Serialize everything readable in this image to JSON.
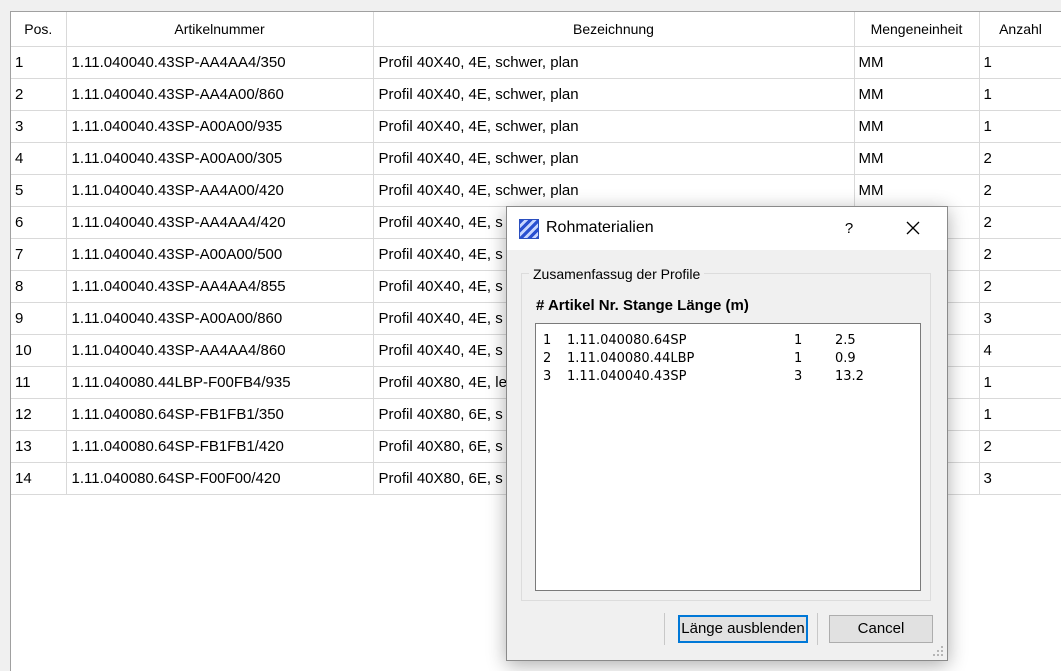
{
  "table": {
    "columns": [
      "Pos.",
      "Artikelnummer",
      "Bezeichnung",
      "Mengeneinheit",
      "Anzahl"
    ],
    "rows": [
      {
        "pos": "1",
        "artikelnummer": "1.11.040040.43SP-AA4AA4/350",
        "bezeichnung": "Profil 40X40, 4E, schwer, plan",
        "einheit": "MM",
        "anzahl": "1"
      },
      {
        "pos": "2",
        "artikelnummer": "1.11.040040.43SP-AA4A00/860",
        "bezeichnung": "Profil 40X40, 4E, schwer, plan",
        "einheit": "MM",
        "anzahl": "1"
      },
      {
        "pos": "3",
        "artikelnummer": "1.11.040040.43SP-A00A00/935",
        "bezeichnung": "Profil 40X40, 4E, schwer, plan",
        "einheit": "MM",
        "anzahl": "1"
      },
      {
        "pos": "4",
        "artikelnummer": "1.11.040040.43SP-A00A00/305",
        "bezeichnung": "Profil 40X40, 4E, schwer, plan",
        "einheit": "MM",
        "anzahl": "2"
      },
      {
        "pos": "5",
        "artikelnummer": "1.11.040040.43SP-AA4A00/420",
        "bezeichnung": "Profil 40X40, 4E, schwer, plan",
        "einheit": "MM",
        "anzahl": "2"
      },
      {
        "pos": "6",
        "artikelnummer": "1.11.040040.43SP-AA4AA4/420",
        "bezeichnung": "Profil 40X40, 4E, s",
        "einheit": "",
        "anzahl": "2"
      },
      {
        "pos": "7",
        "artikelnummer": "1.11.040040.43SP-A00A00/500",
        "bezeichnung": "Profil 40X40, 4E, s",
        "einheit": "",
        "anzahl": "2"
      },
      {
        "pos": "8",
        "artikelnummer": "1.11.040040.43SP-AA4AA4/855",
        "bezeichnung": "Profil 40X40, 4E, s",
        "einheit": "",
        "anzahl": "2"
      },
      {
        "pos": "9",
        "artikelnummer": "1.11.040040.43SP-A00A00/860",
        "bezeichnung": "Profil 40X40, 4E, s",
        "einheit": "",
        "anzahl": "3"
      },
      {
        "pos": "10",
        "artikelnummer": "1.11.040040.43SP-AA4AA4/860",
        "bezeichnung": "Profil 40X40, 4E, s",
        "einheit": "",
        "anzahl": "4"
      },
      {
        "pos": "11",
        "artikelnummer": "1.11.040080.44LBP-F00FB4/935",
        "bezeichnung": "Profil 40X80, 4E, le",
        "einheit": "",
        "anzahl": "1"
      },
      {
        "pos": "12",
        "artikelnummer": "1.11.040080.64SP-FB1FB1/350",
        "bezeichnung": "Profil 40X80, 6E, s",
        "einheit": "",
        "anzahl": "1"
      },
      {
        "pos": "13",
        "artikelnummer": "1.11.040080.64SP-FB1FB1/420",
        "bezeichnung": "Profil 40X80, 6E, s",
        "einheit": "",
        "anzahl": "2"
      },
      {
        "pos": "14",
        "artikelnummer": "1.11.040080.64SP-F00F00/420",
        "bezeichnung": "Profil 40X80, 6E, s",
        "einheit": "",
        "anzahl": "3"
      }
    ]
  },
  "dialog": {
    "title": "Rohmaterialien",
    "help_label": "?",
    "group_title": "Zusamenfassug der Profile",
    "list_header": "# Artikel Nr. Stange Länge (m)",
    "items": [
      {
        "num": "1",
        "artikel": "1.11.040080.64SP",
        "stange": "1",
        "laenge": "2.5"
      },
      {
        "num": "2",
        "artikel": "1.11.040080.44LBP",
        "stange": "1",
        "laenge": "0.9"
      },
      {
        "num": "3",
        "artikel": "1.11.040040.43SP",
        "stange": "3",
        "laenge": "13.2"
      }
    ],
    "primary_button": "Länge ausblenden",
    "cancel_button": "Cancel"
  },
  "colors": {
    "accent_focus": "#0078d7",
    "grid_line": "#d9d9d9"
  }
}
